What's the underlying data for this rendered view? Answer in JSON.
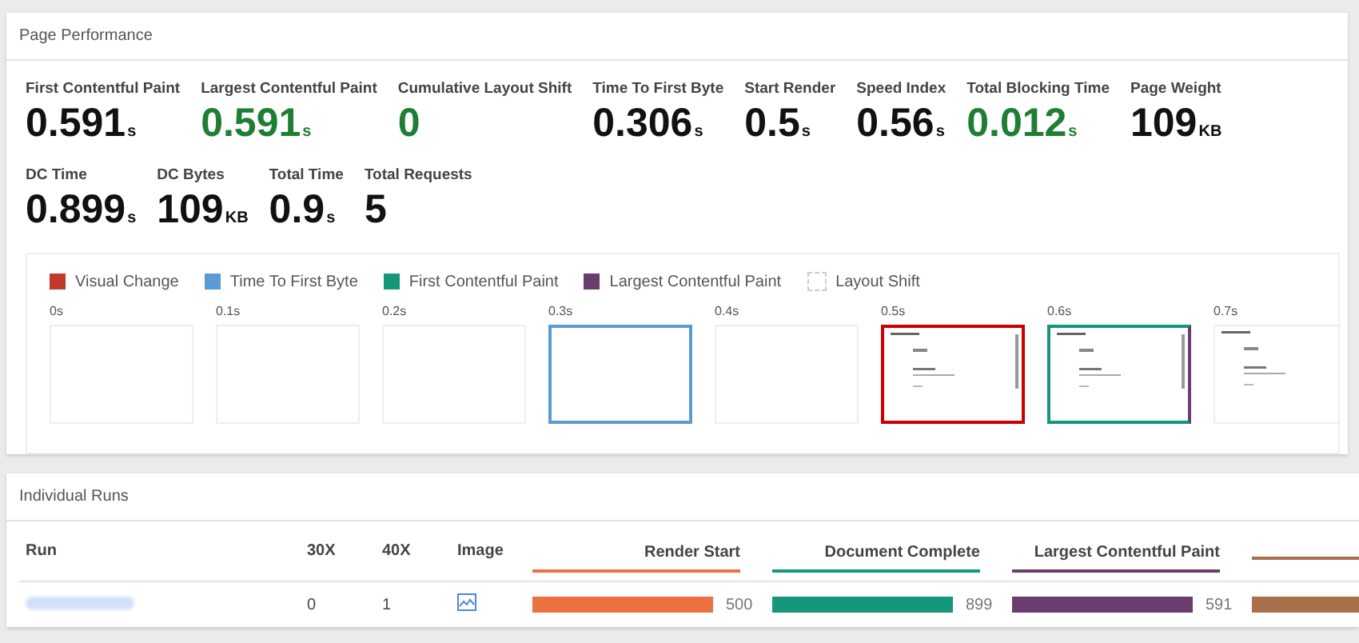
{
  "performance": {
    "title": "Page Performance",
    "metric_rows": [
      [
        {
          "label": "First Contentful Paint",
          "value": "0.591",
          "unit": "s",
          "good": false
        },
        {
          "label": "Largest Contentful Paint",
          "value": "0.591",
          "unit": "s",
          "good": true
        },
        {
          "label": "Cumulative Layout Shift",
          "value": "0",
          "good": true
        },
        {
          "label": "Time To First Byte",
          "value": "0.306",
          "unit": "s",
          "good": false
        },
        {
          "label": "Start Render",
          "value": "0.5",
          "unit": "s",
          "good": false
        },
        {
          "label": "Speed Index",
          "value": "0.56",
          "unit": "s",
          "good": false
        },
        {
          "label": "Total Blocking Time",
          "value": "0.012",
          "unit": "s",
          "good": true
        },
        {
          "label": "Page Weight",
          "value": "109",
          "unit": "KB",
          "good": false
        }
      ],
      [
        {
          "label": "DC Time",
          "value": "0.899",
          "unit": "s",
          "good": false
        },
        {
          "label": "DC Bytes",
          "value": "109",
          "unit": "KB",
          "good": false
        },
        {
          "label": "Total Time",
          "value": "0.9",
          "unit": "s",
          "good": false
        },
        {
          "label": "Total Requests",
          "value": "5",
          "good": false
        }
      ]
    ],
    "legend": [
      {
        "label": "Visual Change",
        "color": "#c0392b"
      },
      {
        "label": "Time To First Byte",
        "color": "#5b9bd5"
      },
      {
        "label": "First Contentful Paint",
        "color": "#16967a"
      },
      {
        "label": "Largest Contentful Paint",
        "color": "#6a3d6e"
      },
      {
        "label": "Layout Shift",
        "kind": "dashed"
      }
    ],
    "frames": [
      {
        "time": "0s",
        "kind": "blank"
      },
      {
        "time": "0.1s",
        "kind": "blank"
      },
      {
        "time": "0.2s",
        "kind": "blank"
      },
      {
        "time": "0.3s",
        "kind": "ttfb"
      },
      {
        "time": "0.4s",
        "kind": "blank"
      },
      {
        "time": "0.5s",
        "kind": "change"
      },
      {
        "time": "0.6s",
        "kind": "paint"
      },
      {
        "time": "0.7s",
        "kind": "rendered"
      }
    ]
  },
  "runs": {
    "title": "Individual Runs",
    "columns": [
      {
        "label": "Run"
      },
      {
        "label": "30X"
      },
      {
        "label": "40X"
      },
      {
        "label": "Image"
      },
      {
        "label": "Render Start",
        "color": "#ec7041"
      },
      {
        "label": "Document Complete",
        "color": "#16967a"
      },
      {
        "label": "Largest Contentful Paint",
        "color": "#6a3d6e"
      },
      {
        "color": "#a8714b"
      }
    ],
    "rows": [
      {
        "c30x": "0",
        "c40x": "1",
        "readings": [
          "500",
          "899",
          "591"
        ]
      }
    ]
  }
}
